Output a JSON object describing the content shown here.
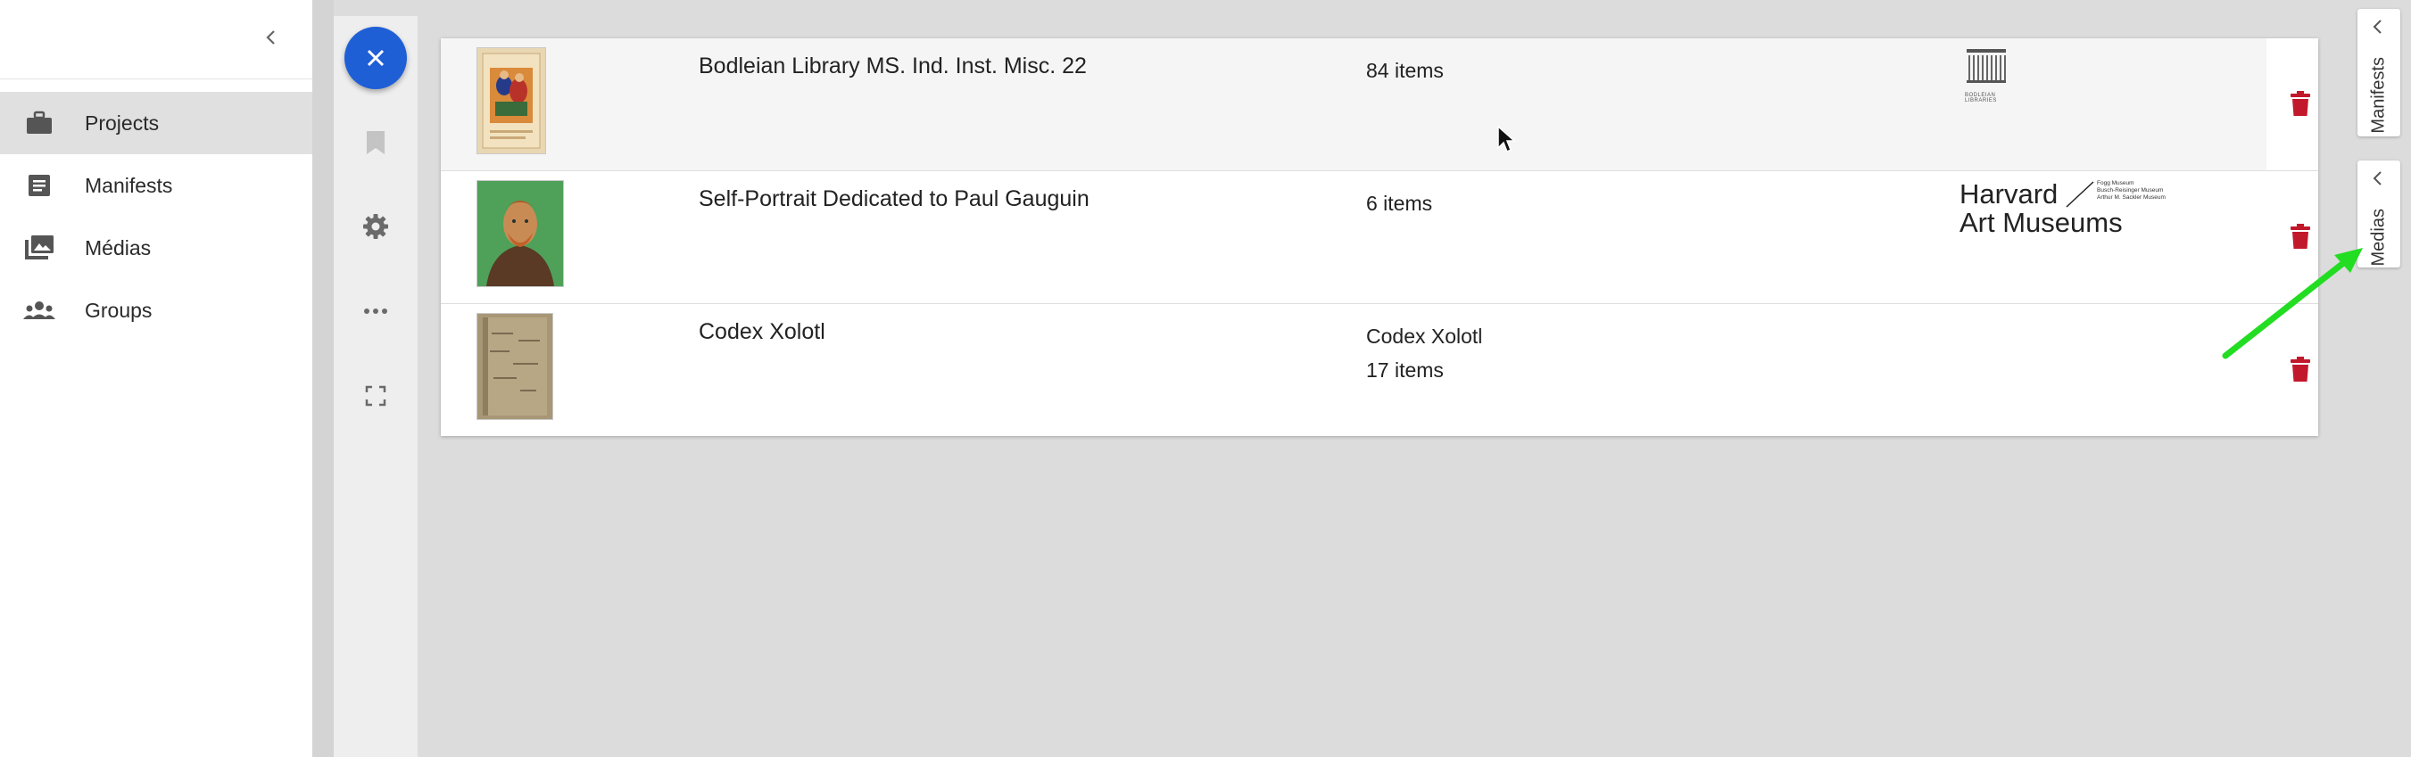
{
  "sidebar": {
    "items": [
      {
        "label": "Projects",
        "icon": "briefcase-icon",
        "active": true
      },
      {
        "label": "Manifests",
        "icon": "document-icon",
        "active": false
      },
      {
        "label": "Médias",
        "icon": "images-icon",
        "active": false
      },
      {
        "label": "Groups",
        "icon": "groups-icon",
        "active": false
      }
    ]
  },
  "toolbar": {
    "close_icon": "close-icon",
    "bookmark_icon": "bookmark-icon",
    "settings_icon": "gear-icon",
    "more_icon": "more-horiz-icon",
    "fullscreen_icon": "fullscreen-icon"
  },
  "manifests": [
    {
      "title": "Bodleian Library MS. Ind. Inst. Misc. 22",
      "count_line1": "84 items",
      "count_line2": "",
      "provider_logo_text": "BODLEIAN LIBRARIES"
    },
    {
      "title": "Self-Portrait Dedicated to Paul Gauguin",
      "count_line1": "6 items",
      "count_line2": "",
      "provider_logo_line1": "Harvard",
      "provider_logo_line2": "Art Museums",
      "provider_logo_small": [
        "Fogg Museum",
        "Busch-Reisinger Museum",
        "Arthur M. Sackler Museum"
      ]
    },
    {
      "title": "Codex Xolotl",
      "count_line1": "Codex Xolotl",
      "count_line2": "17 items"
    }
  ],
  "side_tabs": [
    {
      "label": "Manifests"
    },
    {
      "label": "Medias"
    }
  ],
  "colors": {
    "accent": "#1f5fd6",
    "delete": "#c2182b",
    "annotation_arrow": "#22dd22"
  }
}
